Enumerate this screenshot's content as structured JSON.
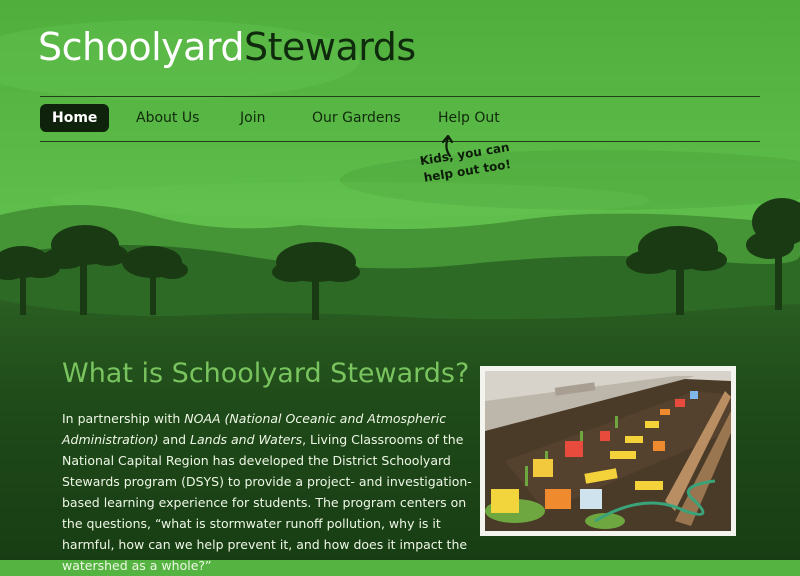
{
  "site": {
    "logo_part1": "Schoolyard",
    "logo_part2": "Stewards"
  },
  "nav": {
    "items": [
      {
        "label": "Home",
        "active": true
      },
      {
        "label": "About Us"
      },
      {
        "label": "Join"
      },
      {
        "label": "Our Gardens"
      },
      {
        "label": "Help Out"
      }
    ]
  },
  "callout": {
    "line1": "Kids, you can",
    "line2": "help out too!"
  },
  "main": {
    "heading": "What is Schoolyard Stewards?",
    "p_text1": "In partnership with ",
    "p_em1": "NOAA (National Oceanic and Atmospheric Administration)",
    "p_text2": " and ",
    "p_em2": "Lands and Waters",
    "p_text3": ", Living Classrooms of the National Capital Region has developed the District Schoolyard Stewards program (DSYS) to provide a project- and investigation-based learning experience for students. The program centers on the questions, “what is stormwater runoff pollution, why is it harmful, how can we help prevent it, and how does it impact the watershed as a whole?”"
  },
  "colors": {
    "sky_green": "#55b441",
    "dark_green": "#1e4818",
    "nav_active": "#0f230c",
    "heading_green": "#79c45e"
  }
}
